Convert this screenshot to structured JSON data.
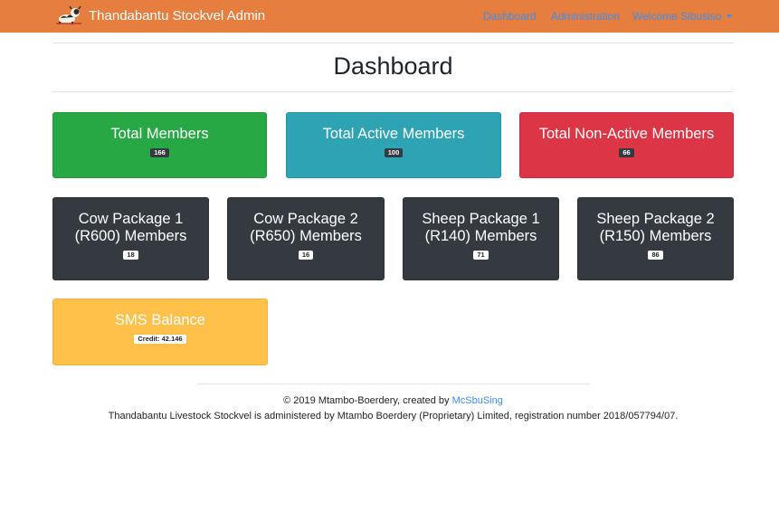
{
  "navbar": {
    "brand": "Thandabantu Stockvel Admin",
    "logo_icon": "cow-logo-icon",
    "links": {
      "dashboard": "Dashboard",
      "administration": "Administration",
      "welcome": "Welcome Sibusiso"
    }
  },
  "page": {
    "title": "Dashboard"
  },
  "summary_cards": [
    {
      "title": "Total Members",
      "count": "166",
      "color": "#28a745"
    },
    {
      "title": "Total Active Members",
      "count": "100",
      "color": "#2ea3b3"
    },
    {
      "title": "Total Non-Active Members",
      "count": "66",
      "color": "#dc3545"
    }
  ],
  "package_cards": [
    {
      "line1": "Cow Package 1",
      "line2": "(R600) Members",
      "count": "18"
    },
    {
      "line1": "Cow Package 2",
      "line2": "(R650) Members",
      "count": "16"
    },
    {
      "line1": "Sheep Package 1",
      "line2": "(R140) Members",
      "count": "71"
    },
    {
      "line1": "Sheep Package 2",
      "line2": "(R150) Members",
      "count": "86"
    }
  ],
  "sms_card": {
    "title": "SMS Balance",
    "credit": "Credit: 42.146",
    "color": "#ffc14a"
  },
  "footer": {
    "copyright": "© 2019 Mtambo-Boerdery, created by ",
    "creator_link": "McSbuSing",
    "notice": "Thandabantu Livestock Stockvel is administered by Mtambo Boerdery (Proprietary) Limited, registration number 2018/057794/07."
  }
}
